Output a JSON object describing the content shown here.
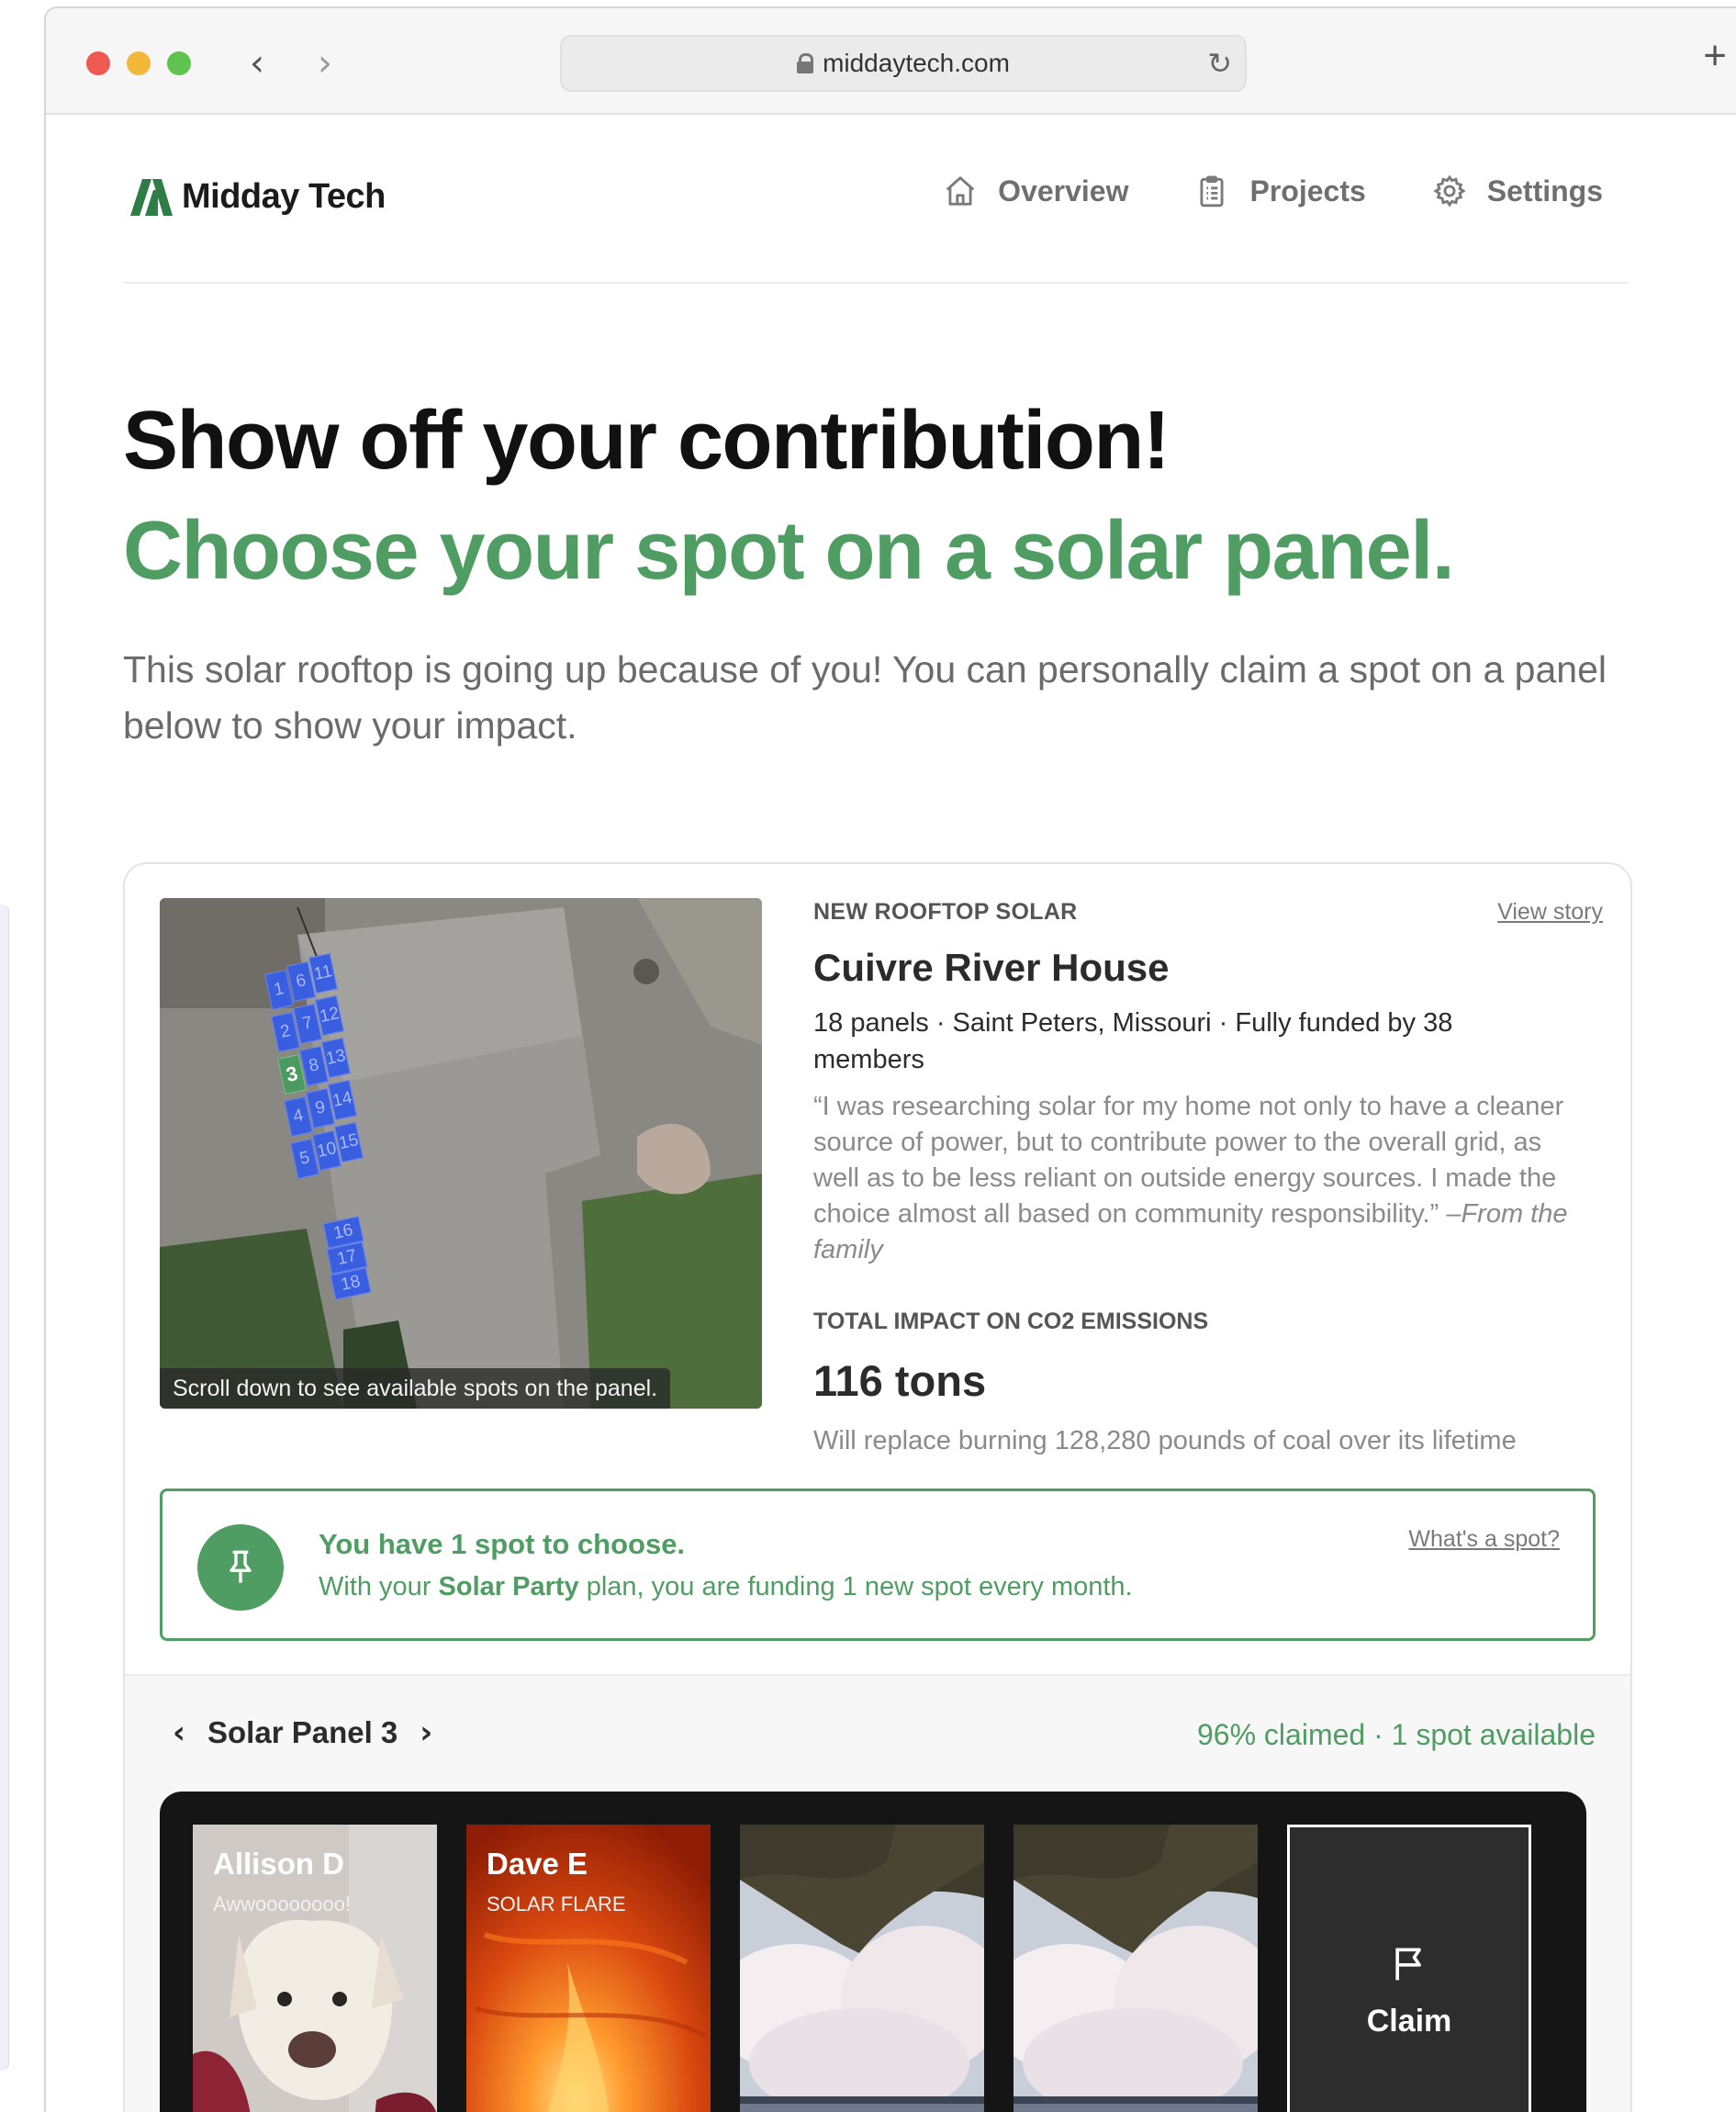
{
  "browser": {
    "url": "middaytech.com"
  },
  "brand": {
    "name": "Midday Tech",
    "accent": "#4f9d63"
  },
  "nav": [
    {
      "label": "Overview",
      "icon": "home-icon"
    },
    {
      "label": "Projects",
      "icon": "clipboard-icon"
    },
    {
      "label": "Settings",
      "icon": "gear-icon"
    }
  ],
  "hero": {
    "title": "Show off your contribution!",
    "subtitle": "Choose your spot on a solar panel.",
    "description": "This solar rooftop is going up because of you! You can personally claim a spot on a panel below to show your impact."
  },
  "project": {
    "map_caption": "Scroll down to see available spots on the panel.",
    "kicker": "NEW ROOFTOP SOLAR",
    "view_story": "View story",
    "title": "Cuivre River House",
    "meta": "18 panels · Saint Peters, Missouri · Fully funded by 38 members",
    "quote": "“I was researching solar for my home not only to have a cleaner source of power, but to contribute power to the overall grid, as well as to be less reliant on outside energy sources. I made the choice almost all based on community responsibility.”",
    "quote_attribution": "–From the family",
    "impact_label": "TOTAL IMPACT ON CO2 EMISSIONS",
    "impact_value": "116 tons",
    "impact_note": "Will replace burning 128,280 pounds of coal over its lifetime",
    "panels": [
      "1",
      "2",
      "3",
      "4",
      "5",
      "6",
      "7",
      "8",
      "9",
      "10",
      "11",
      "12",
      "13",
      "14",
      "15",
      "16",
      "17",
      "18"
    ],
    "selected_panel": "3"
  },
  "notice": {
    "title": "You have 1 spot to choose.",
    "body_prefix": "With your ",
    "plan": "Solar Party",
    "body_suffix": " plan, you are funding 1 new spot every month.",
    "help_link": "What's a spot?"
  },
  "panel_section": {
    "panel_name": "Solar Panel 3",
    "claimed_status": "96% claimed · 1 spot available",
    "tiles": [
      {
        "name": "Allison D",
        "subtitle": "Awwoooooooo!"
      },
      {
        "name": "Dave E",
        "subtitle": "SOLAR FLARE"
      },
      {
        "name": "",
        "subtitle": ""
      },
      {
        "name": "",
        "subtitle": ""
      }
    ],
    "claim_label": "Claim"
  }
}
